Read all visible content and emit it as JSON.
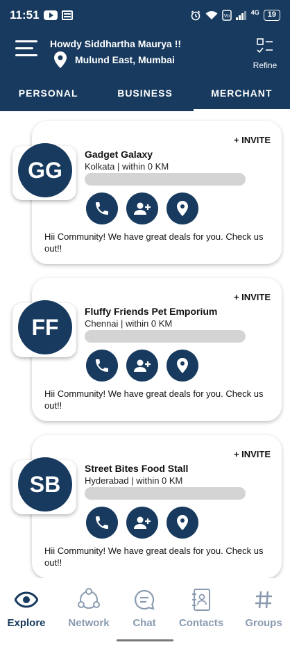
{
  "status": {
    "time": "11:51",
    "network": "4G",
    "battery": "19"
  },
  "header": {
    "greeting": "Howdy Siddhartha Maurya !!",
    "location": "Mulund East, Mumbai",
    "refine_label": "Refine"
  },
  "tabs": [
    {
      "label": "PERSONAL"
    },
    {
      "label": "BUSINESS"
    },
    {
      "label": "MERCHANT"
    }
  ],
  "active_tab": "MERCHANT",
  "cards": [
    {
      "initials": "GG",
      "name": "Gadget Galaxy",
      "location": "Kolkata | within 0 KM",
      "invite": "+ INVITE",
      "message": "Hii Community! We have great deals for you. Check us out!!"
    },
    {
      "initials": "FF",
      "name": "Fluffy Friends Pet Emporium",
      "location": "Chennai | within 0 KM",
      "invite": "+ INVITE",
      "message": "Hii Community! We have great deals for you. Check us out!!"
    },
    {
      "initials": "SB",
      "name": "Street Bites Food Stall",
      "location": "Hyderabad | within 0 KM",
      "invite": "+ INVITE",
      "message": "Hii Community! We have great deals for you. Check us out!!"
    }
  ],
  "bottom_nav": [
    {
      "label": "Explore",
      "icon": "eye-icon",
      "active": true
    },
    {
      "label": "Network",
      "icon": "network-icon",
      "active": false
    },
    {
      "label": "Chat",
      "icon": "chat-icon",
      "active": false
    },
    {
      "label": "Contacts",
      "icon": "contacts-icon",
      "active": false
    },
    {
      "label": "Groups",
      "icon": "hash-icon",
      "active": false
    }
  ],
  "colors": {
    "primary": "#173a5e",
    "inactive": "#8a9bb0",
    "skeleton": "#d4d4d4"
  }
}
